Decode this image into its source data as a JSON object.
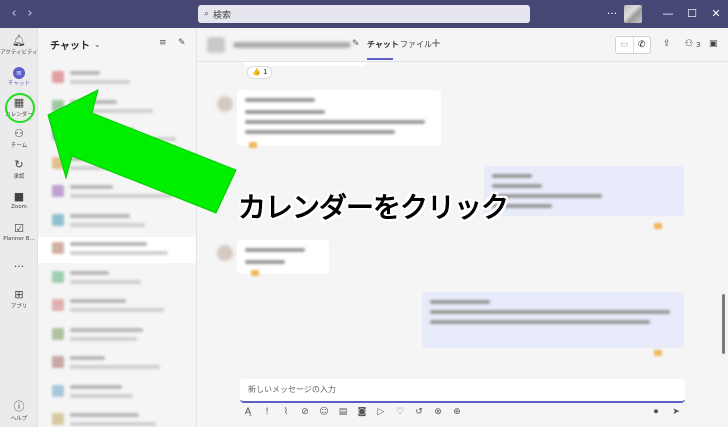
{
  "titlebar": {
    "back_icon": "chevron-left-icon",
    "forward_icon": "chevron-right-icon",
    "search_placeholder": "検索",
    "more": "···",
    "minimize": "—",
    "maximize": "☐",
    "close": "✕"
  },
  "rail": {
    "items": [
      {
        "label": "アクティビティ",
        "icon": "bell-icon"
      },
      {
        "label": "チャット",
        "icon": "chat-icon"
      },
      {
        "label": "カレンダー",
        "icon": "calendar-icon"
      },
      {
        "label": "チーム",
        "icon": "teams-icon"
      },
      {
        "label": "承認",
        "icon": "approvals-icon"
      },
      {
        "label": "Zoom",
        "icon": "video-icon"
      },
      {
        "label": "Planner B...",
        "icon": "planner-icon"
      },
      {
        "label": "···",
        "icon": "more-icon"
      },
      {
        "label": "アプリ",
        "icon": "apps-icon"
      },
      {
        "label": "ヘルプ",
        "icon": "help-icon"
      }
    ]
  },
  "chatlist": {
    "title": "チャット",
    "filter_icon": "filter-icon",
    "compose_icon": "compose-icon"
  },
  "conversation": {
    "tabs": [
      "チャット",
      "ファイル"
    ],
    "add_tab": "+",
    "like_reaction": "👍 1",
    "participants_count": "3"
  },
  "composer": {
    "placeholder": "新しいメッセージの入力"
  },
  "annotation": {
    "text": "カレンダーをクリック",
    "arrow_color": "#00ee00",
    "ring_color": "#22dd22"
  },
  "colors": {
    "titlebar": "#464775",
    "accent": "#5b5fc7"
  }
}
